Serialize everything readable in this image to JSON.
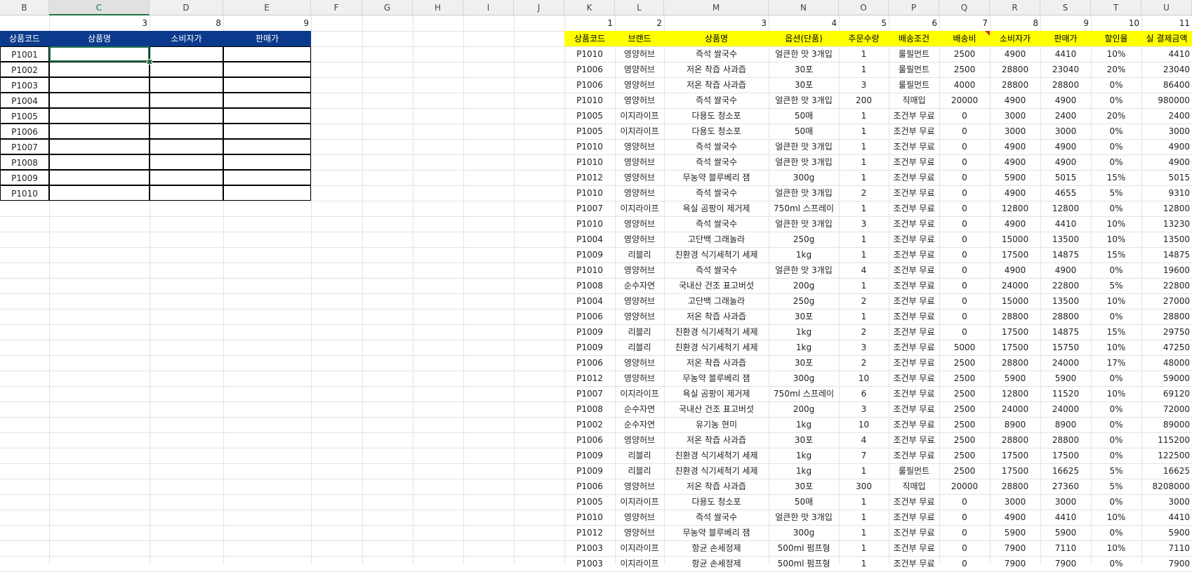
{
  "columns": [
    "B",
    "C",
    "D",
    "E",
    "F",
    "G",
    "H",
    "I",
    "J",
    "K",
    "L",
    "M",
    "N",
    "O",
    "P",
    "Q",
    "R",
    "S",
    "T",
    "U"
  ],
  "selected_column": "C",
  "left_table": {
    "index_row": [
      "",
      "3",
      "8",
      "9"
    ],
    "headers": [
      "상품코드",
      "상품명",
      "소비자가",
      "판매가"
    ],
    "codes": [
      "P1001",
      "P1002",
      "P1003",
      "P1004",
      "P1005",
      "P1006",
      "P1007",
      "P1008",
      "P1009",
      "P1010"
    ]
  },
  "right_table": {
    "index_row": [
      "1",
      "2",
      "3",
      "4",
      "5",
      "6",
      "7",
      "8",
      "9",
      "10",
      "11"
    ],
    "headers": [
      "상품코드",
      "브랜드",
      "상품명",
      "옵션(단품)",
      "주문수량",
      "배송조건",
      "배송비",
      "소비자가",
      "판매가",
      "할인율",
      "실 결제금액"
    ],
    "rows": [
      [
        "P1010",
        "영양허브",
        "즉석 쌀국수",
        "얼큰한 맛 3개입",
        "1",
        "룰필먼트",
        "2500",
        "4900",
        "4410",
        "10%",
        "4410"
      ],
      [
        "P1006",
        "영양허브",
        "저온 착즙 사과즙",
        "30포",
        "1",
        "룰필먼트",
        "2500",
        "28800",
        "23040",
        "20%",
        "23040"
      ],
      [
        "P1006",
        "영양허브",
        "저온 착즙 사과즙",
        "30포",
        "3",
        "룰필먼트",
        "4000",
        "28800",
        "28800",
        "0%",
        "86400"
      ],
      [
        "P1010",
        "영양허브",
        "즉석 쌀국수",
        "얼큰한 맛 3개입",
        "200",
        "직매입",
        "20000",
        "4900",
        "4900",
        "0%",
        "980000"
      ],
      [
        "P1005",
        "이지라이프",
        "다용도 청소포",
        "50매",
        "1",
        "조건부 무료",
        "0",
        "3000",
        "2400",
        "20%",
        "2400"
      ],
      [
        "P1005",
        "이지라이프",
        "다용도 청소포",
        "50매",
        "1",
        "조건부 무료",
        "0",
        "3000",
        "3000",
        "0%",
        "3000"
      ],
      [
        "P1010",
        "영양허브",
        "즉석 쌀국수",
        "얼큰한 맛 3개입",
        "1",
        "조건부 무료",
        "0",
        "4900",
        "4900",
        "0%",
        "4900"
      ],
      [
        "P1010",
        "영양허브",
        "즉석 쌀국수",
        "얼큰한 맛 3개입",
        "1",
        "조건부 무료",
        "0",
        "4900",
        "4900",
        "0%",
        "4900"
      ],
      [
        "P1012",
        "영양허브",
        "무농약 블루베리 잼",
        "300g",
        "1",
        "조건부 무료",
        "0",
        "5900",
        "5015",
        "15%",
        "5015"
      ],
      [
        "P1010",
        "영양허브",
        "즉석 쌀국수",
        "얼큰한 맛 3개입",
        "2",
        "조건부 무료",
        "0",
        "4900",
        "4655",
        "5%",
        "9310"
      ],
      [
        "P1007",
        "이지라이프",
        "욕실 곰팡이 제거제",
        "750ml 스프레이",
        "1",
        "조건부 무료",
        "0",
        "12800",
        "12800",
        "0%",
        "12800"
      ],
      [
        "P1010",
        "영양허브",
        "즉석 쌀국수",
        "얼큰한 맛 3개입",
        "3",
        "조건부 무료",
        "0",
        "4900",
        "4410",
        "10%",
        "13230"
      ],
      [
        "P1004",
        "영양허브",
        "고단백 그래놀라",
        "250g",
        "1",
        "조건부 무료",
        "0",
        "15000",
        "13500",
        "10%",
        "13500"
      ],
      [
        "P1009",
        "리블리",
        "친환경 식기세척기 세제",
        "1kg",
        "1",
        "조건부 무료",
        "0",
        "17500",
        "14875",
        "15%",
        "14875"
      ],
      [
        "P1010",
        "영양허브",
        "즉석 쌀국수",
        "얼큰한 맛 3개입",
        "4",
        "조건부 무료",
        "0",
        "4900",
        "4900",
        "0%",
        "19600"
      ],
      [
        "P1008",
        "순수자연",
        "국내산 건조 표고버섯",
        "200g",
        "1",
        "조건부 무료",
        "0",
        "24000",
        "22800",
        "5%",
        "22800"
      ],
      [
        "P1004",
        "영양허브",
        "고단백 그래놀라",
        "250g",
        "2",
        "조건부 무료",
        "0",
        "15000",
        "13500",
        "10%",
        "27000"
      ],
      [
        "P1006",
        "영양허브",
        "저온 착즙 사과즙",
        "30포",
        "1",
        "조건부 무료",
        "0",
        "28800",
        "28800",
        "0%",
        "28800"
      ],
      [
        "P1009",
        "리블리",
        "친환경 식기세척기 세제",
        "1kg",
        "2",
        "조건부 무료",
        "0",
        "17500",
        "14875",
        "15%",
        "29750"
      ],
      [
        "P1009",
        "리블리",
        "친환경 식기세척기 세제",
        "1kg",
        "3",
        "조건부 무료",
        "5000",
        "17500",
        "15750",
        "10%",
        "47250"
      ],
      [
        "P1006",
        "영양허브",
        "저온 착즙 사과즙",
        "30포",
        "2",
        "조건부 무료",
        "2500",
        "28800",
        "24000",
        "17%",
        "48000"
      ],
      [
        "P1012",
        "영양허브",
        "무농약 블루베리 잼",
        "300g",
        "10",
        "조건부 무료",
        "2500",
        "5900",
        "5900",
        "0%",
        "59000"
      ],
      [
        "P1007",
        "이지라이프",
        "욕실 곰팡이 제거제",
        "750ml 스프레이",
        "6",
        "조건부 무료",
        "2500",
        "12800",
        "11520",
        "10%",
        "69120"
      ],
      [
        "P1008",
        "순수자연",
        "국내산 건조 표고버섯",
        "200g",
        "3",
        "조건부 무료",
        "2500",
        "24000",
        "24000",
        "0%",
        "72000"
      ],
      [
        "P1002",
        "순수자연",
        "유기농 현미",
        "1kg",
        "10",
        "조건부 무료",
        "2500",
        "8900",
        "8900",
        "0%",
        "89000"
      ],
      [
        "P1006",
        "영양허브",
        "저온 착즙 사과즙",
        "30포",
        "4",
        "조건부 무료",
        "2500",
        "28800",
        "28800",
        "0%",
        "115200"
      ],
      [
        "P1009",
        "리블리",
        "친환경 식기세척기 세제",
        "1kg",
        "7",
        "조건부 무료",
        "2500",
        "17500",
        "17500",
        "0%",
        "122500"
      ],
      [
        "P1009",
        "리블리",
        "친환경 식기세척기 세제",
        "1kg",
        "1",
        "룰필먼트",
        "2500",
        "17500",
        "16625",
        "5%",
        "16625"
      ],
      [
        "P1006",
        "영양허브",
        "저온 착즙 사과즙",
        "30포",
        "300",
        "직매입",
        "20000",
        "28800",
        "27360",
        "5%",
        "8208000"
      ],
      [
        "P1005",
        "이지라이프",
        "다용도 청소포",
        "50매",
        "1",
        "조건부 무료",
        "0",
        "3000",
        "3000",
        "0%",
        "3000"
      ],
      [
        "P1010",
        "영양허브",
        "즉석 쌀국수",
        "얼큰한 맛 3개입",
        "1",
        "조건부 무료",
        "0",
        "4900",
        "4410",
        "10%",
        "4410"
      ],
      [
        "P1012",
        "영양허브",
        "무농약 블루베리 잼",
        "300g",
        "1",
        "조건부 무료",
        "0",
        "5900",
        "5900",
        "0%",
        "5900"
      ],
      [
        "P1003",
        "이지라이프",
        "항균 손세정제",
        "500ml 펌프형",
        "1",
        "조건부 무료",
        "0",
        "7900",
        "7110",
        "10%",
        "7110"
      ],
      [
        "P1003",
        "이지라이프",
        "항균 손세정제",
        "500ml 펌프형",
        "1",
        "조건부 무료",
        "0",
        "7900",
        "7900",
        "0%",
        "7900"
      ]
    ]
  },
  "colors": {
    "left_header_bg": "#0b3a8c",
    "right_header_bg": "#ffff00",
    "selection": "#1e7145",
    "comment_indicator": "#e02020"
  }
}
